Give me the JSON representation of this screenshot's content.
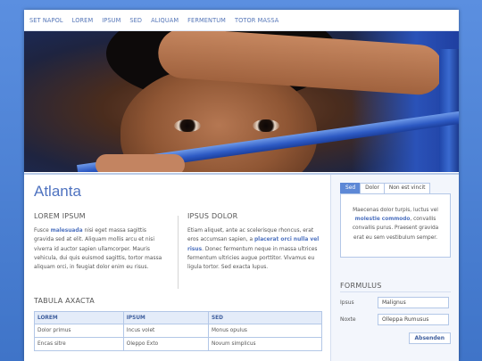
{
  "nav": [
    "SET NAPOL",
    "LOREM",
    "IPSUM",
    "SED",
    "ALIQUAM",
    "FERMENTUM",
    "TOTOR MASSA"
  ],
  "main": {
    "title": "Atlanta",
    "col1": {
      "heading": "LOREM IPSUM",
      "text_a": "Fusce ",
      "link": "malesuada",
      "text_b": " nisi eget massa sagittis gravida sed at elit. Aliquam mollis arcu et nisi viverra id auctor sapien ullamcorper. Mauris vehicula, dui quis euismod sagittis, tortor massa aliquam orci, in feugiat dolor enim eu risus."
    },
    "col2": {
      "heading": "IPSUS DOLOR",
      "text_a": "Etiam aliquet, ante ac scelerisque rhoncus, erat eros accumsan sapien, a ",
      "link": "placerat orci nulla vel risus",
      "text_b": ". Donec fermentum neque in massa ultrices fermentum ultricies augue porttitor. Vivamus eu ligula tortor. Sed exacta lupus."
    },
    "tabula": {
      "heading": "TABULA AXACTA",
      "headers": [
        "LOREM",
        "IPSUM",
        "SED"
      ],
      "rows": [
        [
          "Dolor primus",
          "Incus volet",
          "Monus opulus"
        ],
        [
          "Encas sitre",
          "Oleppo Exto",
          "Novum simplicus"
        ]
      ]
    }
  },
  "side": {
    "tabs": [
      "Sed",
      "Dolor",
      "Non est vincit"
    ],
    "panel": {
      "text_a": "Maecenas dolor turpis, luctus vel ",
      "link": "molestie commodo",
      "text_b": ", convallis convallis purus. Praesent gravida erat eu sem vestibulum semper."
    },
    "formulus": {
      "heading": "FORMULUS",
      "fields": [
        {
          "label": "Ipsus",
          "value": "Malignus"
        },
        {
          "label": "Noxte",
          "value": "Olleppa Rumusus"
        }
      ],
      "button": "Absenden"
    }
  },
  "colors": {
    "accent": "#4f73c0",
    "background": "#4a7fd0",
    "tab_active": "#5d88d6"
  }
}
